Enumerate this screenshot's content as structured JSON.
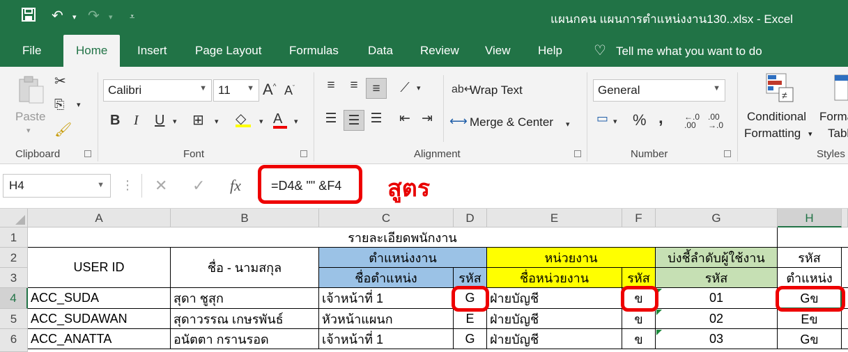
{
  "window": {
    "title": "แผนกคน แผนการตำแหน่งงาน130..xlsx  -  Excel"
  },
  "ribbon_tabs": [
    "File",
    "Home",
    "Insert",
    "Page Layout",
    "Formulas",
    "Data",
    "Review",
    "View",
    "Help"
  ],
  "active_tab": "Home",
  "tell_me": "Tell me what you want to do",
  "ribbon": {
    "clipboard": {
      "paste": "Paste",
      "label": "Clipboard"
    },
    "font": {
      "name": "Calibri",
      "size": "11",
      "label": "Font"
    },
    "alignment": {
      "wrap_text": "Wrap Text",
      "merge_center": "Merge & Center",
      "label": "Alignment"
    },
    "number": {
      "format": "General",
      "label": "Number",
      "percent": "%",
      "comma": ",",
      "inc_decimal_top": "←.0",
      "inc_decimal_bottom": ".00",
      "dec_decimal_top": ".00",
      "dec_decimal_bottom": "→.0"
    },
    "styles": {
      "conditional_1": "Conditional",
      "conditional_2": "Formatting",
      "format_1": "Format",
      "format_2": "Table",
      "label": "Styles"
    }
  },
  "formula_bar": {
    "name_box": "H4",
    "formula": "=D4& \"\" &F4",
    "annotation": "สูตร"
  },
  "columns": [
    "A",
    "B",
    "C",
    "D",
    "E",
    "F",
    "G",
    "H"
  ],
  "selected_column": "H",
  "row_numbers": [
    "1",
    "2",
    "3",
    "4",
    "5",
    "6"
  ],
  "selected_row": "4",
  "header": {
    "row1": "รายละเอียดพนักงาน",
    "user_id": "USER ID",
    "name": "ชื่อ - นามสกุล",
    "position_group": "ตำแหน่งงาน",
    "position_name": "ชื่อตำแหน่ง",
    "position_code": "รหัส",
    "unit_group": "หน่วยงาน",
    "unit_name": "ชื่อหน่วยงาน",
    "unit_code": "รหัส",
    "seq_group": "บ่งชี้ลำดับผู้ใช้งาน",
    "seq_code": "รหัส",
    "h_top": "รหัส",
    "h_bottom": "ตำแหน่ง"
  },
  "rows": [
    {
      "user_id": "ACC_SUDA",
      "name": "สุดา ชูสุก",
      "position": "เจ้าหน้าที่ 1",
      "pos_code": "G",
      "unit": "ฝ่ายบัญชี",
      "unit_code": "ข",
      "seq": "01",
      "combined": "Gข"
    },
    {
      "user_id": "ACC_SUDAWAN",
      "name": "สุดาวรรณ เกษรพันธ์",
      "position": "หัวหน้าแผนก",
      "pos_code": "E",
      "unit": "ฝ่ายบัญชี",
      "unit_code": "ข",
      "seq": "02",
      "combined": "Eข"
    },
    {
      "user_id": "ACC_ANATTA",
      "name": "อนัตตา กรานรอด",
      "position": "เจ้าหน้าที่ 1",
      "pos_code": "G",
      "unit": "ฝ่ายบัญชี",
      "unit_code": "ข",
      "seq": "03",
      "combined": "Gข"
    }
  ],
  "colors": {
    "excel_green": "#217346",
    "blue_header": "#9bc2e6",
    "yellow_header": "#ffff00",
    "green_header": "#c6e0b4",
    "highlight_red": "#ee0000"
  }
}
